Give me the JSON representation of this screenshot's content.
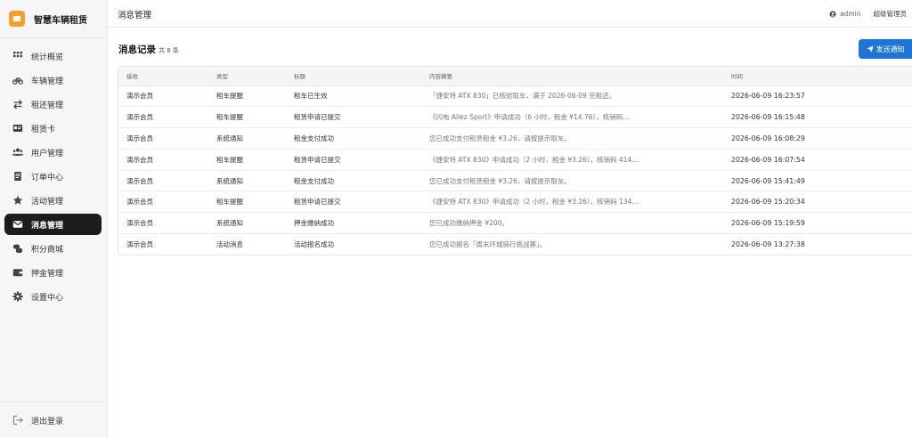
{
  "brand": {
    "name": "智慧车辆租赁"
  },
  "sidebar": {
    "items": [
      {
        "label": "统计概览",
        "icon": "grid-icon"
      },
      {
        "label": "车辆管理",
        "icon": "bicycle-icon"
      },
      {
        "label": "租还管理",
        "icon": "exchange-icon"
      },
      {
        "label": "租赁卡",
        "icon": "card-icon"
      },
      {
        "label": "用户管理",
        "icon": "users-icon"
      },
      {
        "label": "订单中心",
        "icon": "document-icon"
      },
      {
        "label": "活动管理",
        "icon": "star-icon"
      },
      {
        "label": "消息管理",
        "icon": "envelope-icon",
        "active": true
      },
      {
        "label": "积分商城",
        "icon": "coins-icon"
      },
      {
        "label": "押金管理",
        "icon": "wallet-icon"
      },
      {
        "label": "设置中心",
        "icon": "gear-icon"
      }
    ],
    "logout_label": "退出登录"
  },
  "topbar": {
    "title": "消息管理",
    "user": "admin",
    "role": "超级管理员"
  },
  "main": {
    "section_title": "消息记录",
    "section_count": "共 8 条",
    "send_button": "发送通知",
    "columns": [
      "接收",
      "类型",
      "标题",
      "内容摘要",
      "时间"
    ],
    "rows": [
      [
        "演示会员",
        "租车提醒",
        "租车已生效",
        "「捷安特 ATX 830」已核验取车，满于 2026-06-09 完租还。",
        "2026-06-09 16:23:57"
      ],
      [
        "演示会员",
        "租车提醒",
        "租赁申请已提交",
        "《闪电 Allez Sport》申请成功（6 小时，租金 ¥14.76），核销码...",
        "2026-06-09 16:15:48"
      ],
      [
        "演示会员",
        "系统通知",
        "租金支付成功",
        "您已成功支付租赁租金 ¥3.26，请按提示取车。",
        "2026-06-09 16:08:29"
      ],
      [
        "演示会员",
        "租车提醒",
        "租赁申请已提交",
        "《捷安特 ATX 830》申请成功（2 小时，租金 ¥3.26），核销码 414...",
        "2026-06-09 16:07:54"
      ],
      [
        "演示会员",
        "系统通知",
        "租金支付成功",
        "您已成功支付租赁租金 ¥3.26，请按提示取车。",
        "2026-06-09 15:41:49"
      ],
      [
        "演示会员",
        "租车提醒",
        "租赁申请已提交",
        "《捷安特 ATX 830》申请成功（2 小时，租金 ¥3.26），核销码 134...",
        "2026-06-09 15:20:34"
      ],
      [
        "演示会员",
        "系统通知",
        "押金缴纳成功",
        "您已成功缴纳押金 ¥200。",
        "2026-06-09 15:19:59"
      ],
      [
        "演示会员",
        "活动消息",
        "活动报名成功",
        "您已成功报名「周末环城骑行挑战赛」。",
        "2026-06-09 13:27:38"
      ]
    ]
  },
  "colors": {
    "accent": "#1e74d9",
    "active_nav": "#1c1c1f",
    "brand": "#f4a02a"
  }
}
